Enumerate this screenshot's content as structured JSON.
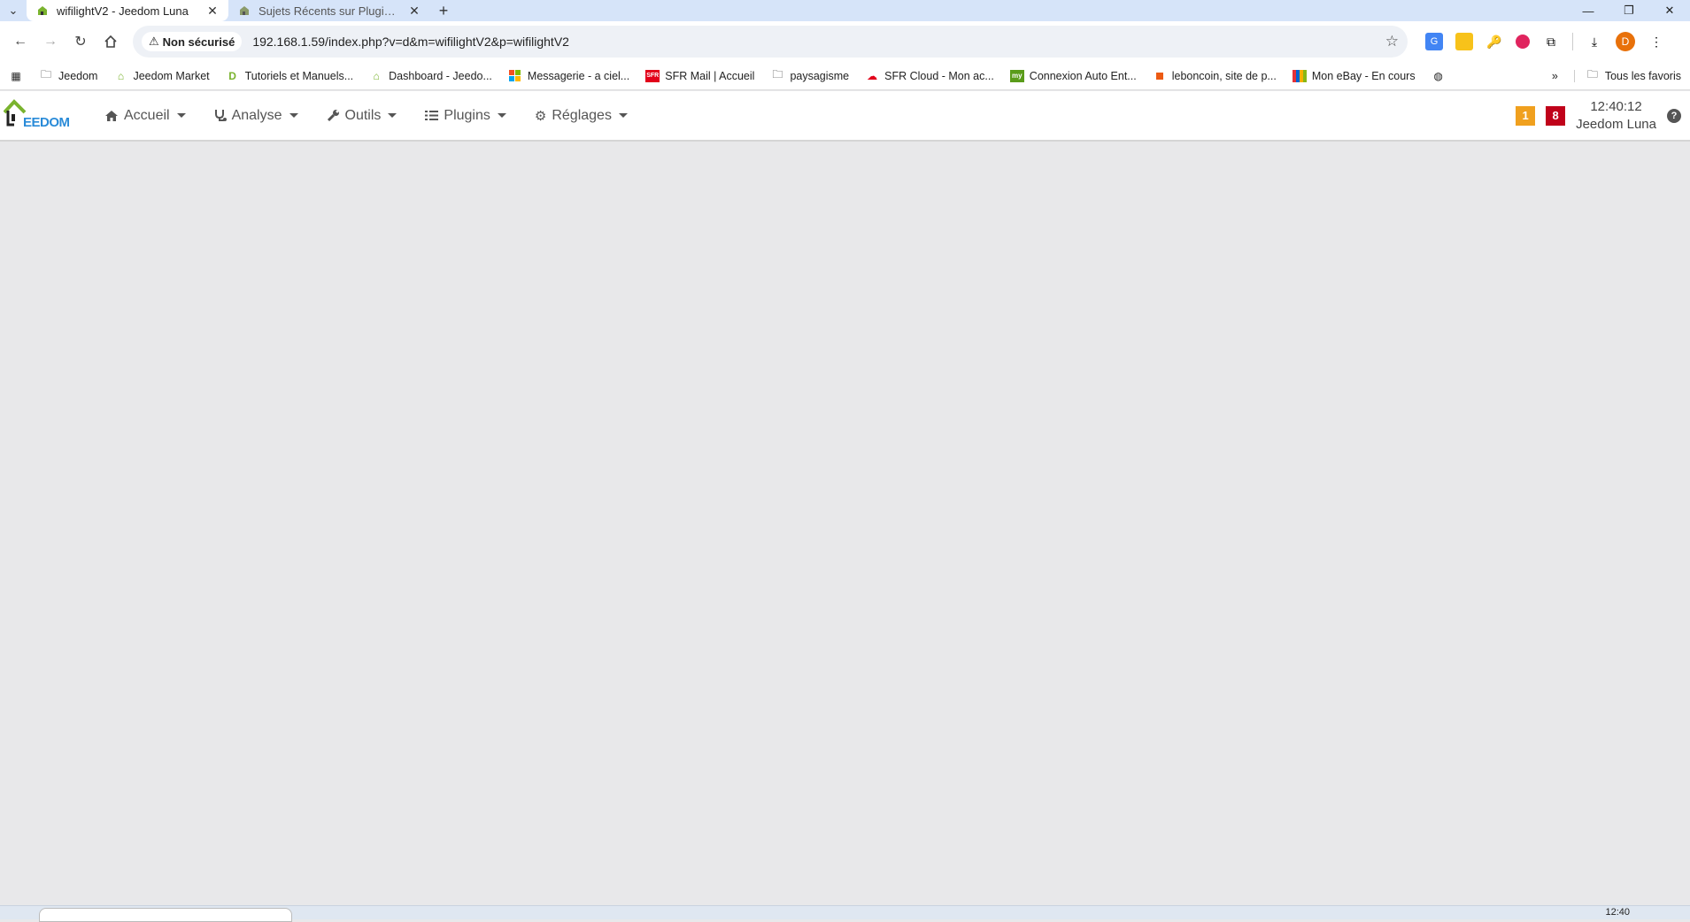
{
  "browser": {
    "tabs": [
      {
        "title": "wifilightV2 - Jeedom Luna",
        "active": true
      },
      {
        "title": "Sujets Récents sur Plugins/Objets",
        "active": false
      }
    ],
    "security_label": "Non sécurisé",
    "url": "192.168.1.59/index.php?v=d&m=wifilightV2&p=wifilightV2",
    "profile_initial": "D"
  },
  "bookmarks": {
    "items": [
      {
        "label": "Jeedom",
        "icon": "folder-icon"
      },
      {
        "label": "Jeedom Market",
        "icon": "jeedom-icon"
      },
      {
        "label": "Tutoriels et Manuels...",
        "icon": "d-icon"
      },
      {
        "label": "Dashboard - Jeedo...",
        "icon": "jeedom-icon"
      },
      {
        "label": "Messagerie - a ciel...",
        "icon": "microsoft-icon"
      },
      {
        "label": "SFR Mail | Accueil",
        "icon": "sfr-icon"
      },
      {
        "label": "paysagisme",
        "icon": "folder-icon"
      },
      {
        "label": "SFR Cloud - Mon ac...",
        "icon": "cloud-icon"
      },
      {
        "label": "Connexion Auto Ent...",
        "icon": "my-icon"
      },
      {
        "label": "leboncoin, site de p...",
        "icon": "leboncoin-icon"
      },
      {
        "label": "Mon eBay - En cours",
        "icon": "ebay-icon"
      }
    ],
    "all_bookmarks": "Tous les favoris"
  },
  "app": {
    "brand": "EEDOM",
    "menu": [
      {
        "label": "Accueil",
        "icon": "home-icon"
      },
      {
        "label": "Analyse",
        "icon": "stethoscope-icon"
      },
      {
        "label": "Outils",
        "icon": "wrench-icon"
      },
      {
        "label": "Plugins",
        "icon": "list-icon"
      },
      {
        "label": "Réglages",
        "icon": "gear-icon"
      }
    ],
    "badge_warning": "1",
    "badge_alert": "8",
    "time": "12:40:12",
    "system_name": "Jeedom Luna"
  },
  "taskbar": {
    "time": "12:40"
  },
  "colors": {
    "tab_bar": "#d6e4f9",
    "badge_warning": "#f0a01e",
    "badge_alert": "#c0021a",
    "content_bg": "#e8e8ea"
  }
}
